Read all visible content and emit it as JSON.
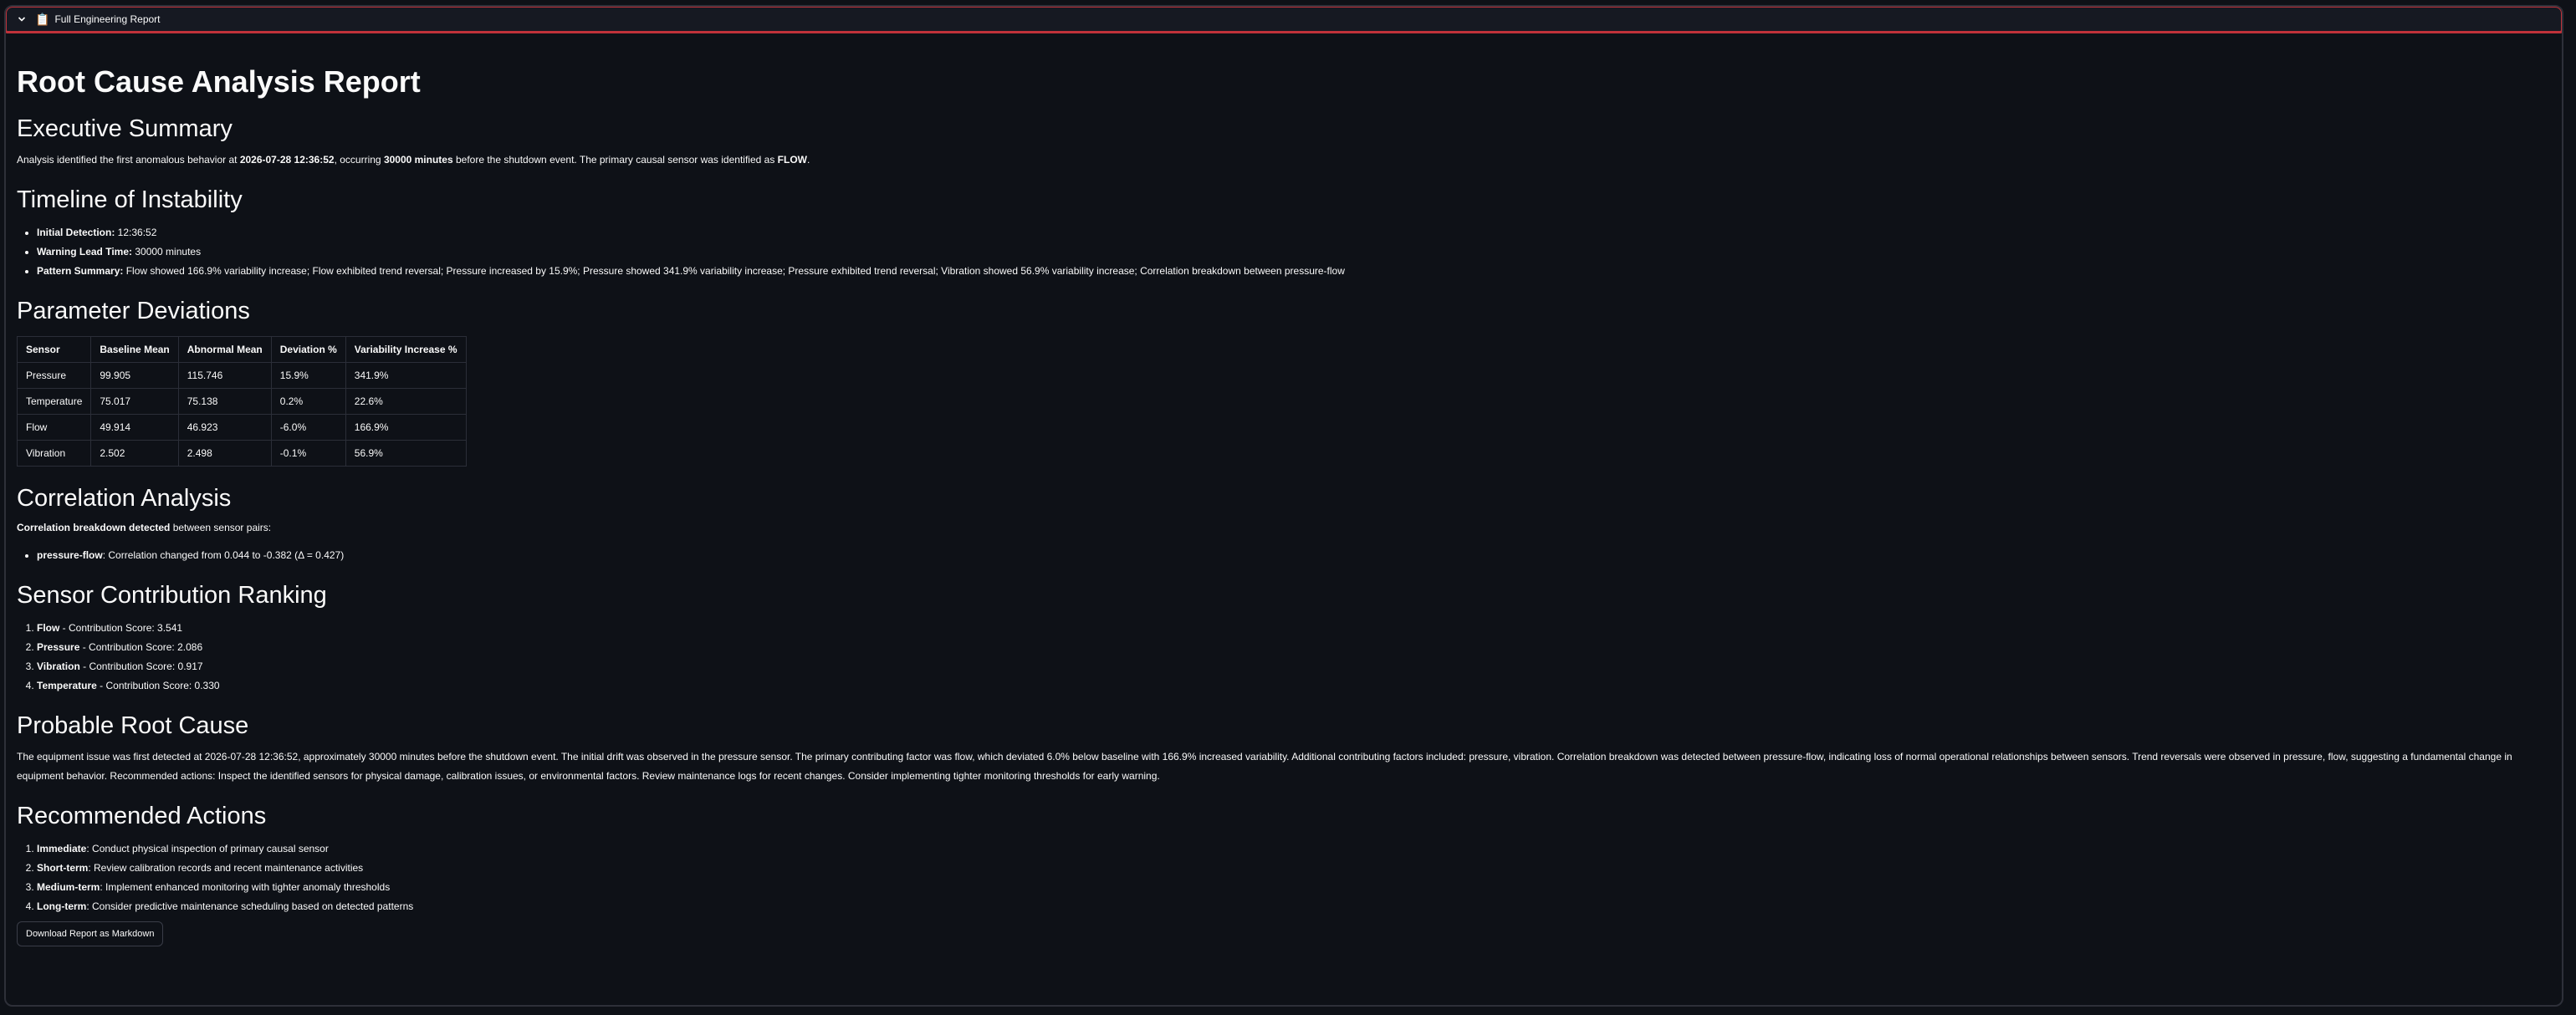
{
  "expander": {
    "icon": "clipboard-icon",
    "icon_glyph": "📋",
    "label": "Full Engineering Report"
  },
  "report": {
    "title": "Root Cause Analysis Report",
    "executive_summary": {
      "heading": "Executive Summary",
      "text_1": "Analysis identified the first anomalous behavior at ",
      "detect_time": "2026-07-28 12:36:52",
      "text_2": ", occurring ",
      "lead": "30000 minutes",
      "text_3": " before the shutdown event. The primary causal sensor was identified as ",
      "sensor": "FLOW",
      "text_4": "."
    },
    "timeline": {
      "heading": "Timeline of Instability",
      "items": [
        {
          "label": "Initial Detection:",
          "value": " 12:36:52"
        },
        {
          "label": "Warning Lead Time:",
          "value": " 30000 minutes"
        },
        {
          "label": "Pattern Summary:",
          "value": " Flow showed 166.9% variability increase; Flow exhibited trend reversal; Pressure increased by 15.9%; Pressure showed 341.9% variability increase; Pressure exhibited trend reversal; Vibration showed 56.9% variability increase; Correlation breakdown between pressure-flow"
        }
      ]
    },
    "deviations": {
      "heading": "Parameter Deviations",
      "columns": [
        "Sensor",
        "Baseline Mean",
        "Abnormal Mean",
        "Deviation %",
        "Variability Increase %"
      ],
      "rows": [
        [
          "Pressure",
          "99.905",
          "115.746",
          "15.9%",
          "341.9%"
        ],
        [
          "Temperature",
          "75.017",
          "75.138",
          "0.2%",
          "22.6%"
        ],
        [
          "Flow",
          "49.914",
          "46.923",
          "-6.0%",
          "166.9%"
        ],
        [
          "Vibration",
          "2.502",
          "2.498",
          "-0.1%",
          "56.9%"
        ]
      ]
    },
    "correlation": {
      "heading": "Correlation Analysis",
      "intro_bold": "Correlation breakdown detected",
      "intro_rest": " between sensor pairs:",
      "items": [
        {
          "label": "pressure-flow",
          "value": ": Correlation changed from 0.044 to -0.382 (Δ = 0.427)"
        }
      ]
    },
    "ranking": {
      "heading": "Sensor Contribution Ranking",
      "items": [
        {
          "label": "Flow",
          "value": " - Contribution Score: 3.541"
        },
        {
          "label": "Pressure",
          "value": " - Contribution Score: 2.086"
        },
        {
          "label": "Vibration",
          "value": " - Contribution Score: 0.917"
        },
        {
          "label": "Temperature",
          "value": " - Contribution Score: 0.330"
        }
      ]
    },
    "root_cause": {
      "heading": "Probable Root Cause",
      "text": "The equipment issue was first detected at 2026-07-28 12:36:52, approximately 30000 minutes before the shutdown event. The initial drift was observed in the pressure sensor. The primary contributing factor was flow, which deviated 6.0% below baseline with 166.9% increased variability. Additional contributing factors included: pressure, vibration. Correlation breakdown was detected between pressure-flow, indicating loss of normal operational relationships between sensors. Trend reversals were observed in pressure, flow, suggesting a fundamental change in equipment behavior. Recommended actions: Inspect the identified sensors for physical damage, calibration issues, or environmental factors. Review maintenance logs for recent changes. Consider implementing tighter monitoring thresholds for early warning."
    },
    "actions": {
      "heading": "Recommended Actions",
      "items": [
        {
          "label": "Immediate",
          "value": ": Conduct physical inspection of primary causal sensor"
        },
        {
          "label": "Short-term",
          "value": ": Review calibration records and recent maintenance activities"
        },
        {
          "label": "Medium-term",
          "value": ": Implement enhanced monitoring with tighter anomaly thresholds"
        },
        {
          "label": "Long-term",
          "value": ": Consider predictive maintenance scheduling based on detected patterns"
        }
      ]
    },
    "download_label": "Download Report as Markdown"
  },
  "colors": {
    "background": "#0e1117",
    "text": "#fafafa",
    "expander_border": "#c0323a",
    "table_border": "#2b2e38"
  }
}
